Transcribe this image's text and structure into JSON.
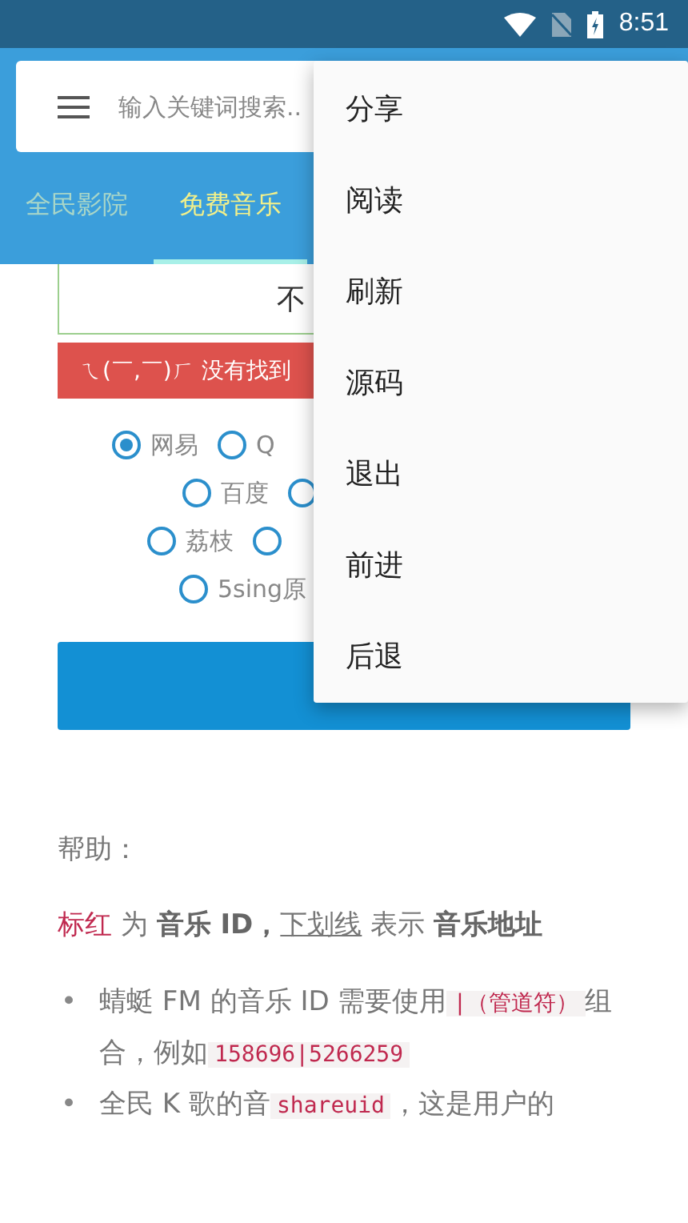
{
  "status_bar": {
    "time": "8:51"
  },
  "search": {
    "placeholder": "输入关键词搜索.."
  },
  "tabs": [
    {
      "label": "全民影院",
      "selected": false
    },
    {
      "label": "免费音乐",
      "selected": true
    }
  ],
  "query_box": {
    "value": "不"
  },
  "error_banner": {
    "text": "ㄟ(￣,￣)ㄏ 没有找到"
  },
  "sources": [
    [
      {
        "label": "网易",
        "selected": true
      },
      {
        "label": "Q",
        "selected": false
      }
    ],
    [
      {
        "label": "百度",
        "selected": false
      },
      {
        "selected": false
      }
    ],
    [
      {
        "label": "荔枝",
        "selected": false
      },
      {
        "selected": false
      }
    ],
    [
      {
        "label": "5sing原",
        "selected": false
      }
    ]
  ],
  "help": {
    "title": "帮助：",
    "legend": [
      {
        "kind": "red",
        "text": "标红"
      },
      {
        "kind": "plain",
        "text": " 为 "
      },
      {
        "kind": "bold",
        "text": "音乐 ID，"
      },
      {
        "kind": "underline",
        "text": "下划线"
      },
      {
        "kind": "plain",
        "text": " 表示 "
      },
      {
        "kind": "bold",
        "text": "音乐地址"
      }
    ],
    "bullets": [
      {
        "marker": "•",
        "parts": [
          {
            "kind": "plain",
            "text": "蜻蜓 FM 的音乐 ID 需要使用"
          },
          {
            "kind": "code",
            "text": "|（管道符）"
          },
          {
            "kind": "plain",
            "text": "组合，例如"
          },
          {
            "kind": "code",
            "text": "158696|5266259"
          }
        ]
      },
      {
        "marker": "•",
        "parts": [
          {
            "kind": "plain",
            "text": "全民 K 歌的音"
          },
          {
            "kind": "code",
            "text": "shareuid"
          },
          {
            "kind": "plain",
            "text": "，这是用户的"
          }
        ]
      }
    ]
  },
  "menu": [
    {
      "label": "分享"
    },
    {
      "label": "阅读"
    },
    {
      "label": "刷新"
    },
    {
      "label": "源码"
    },
    {
      "label": "退出"
    },
    {
      "label": "前进"
    },
    {
      "label": "后退"
    }
  ]
}
